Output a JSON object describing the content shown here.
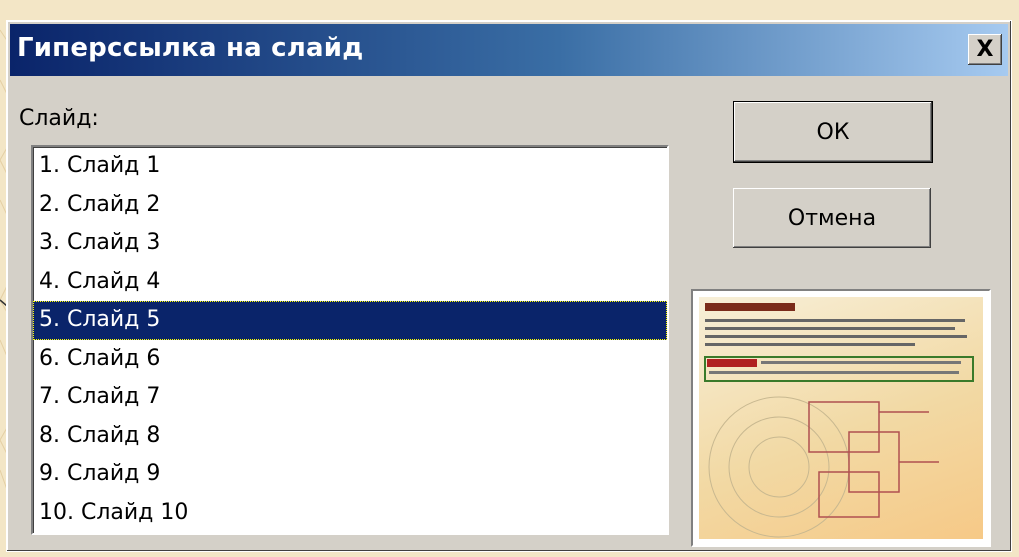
{
  "dialog": {
    "title": "Гиперссылка на слайд",
    "close_label": "X"
  },
  "list": {
    "label": "Слайд:",
    "items": [
      {
        "label": "1. Слайд 1"
      },
      {
        "label": "2. Слайд 2"
      },
      {
        "label": "3. Слайд 3"
      },
      {
        "label": "4. Слайд 4"
      },
      {
        "label": "5. Слайд 5",
        "selected": true
      },
      {
        "label": "6. Слайд 6"
      },
      {
        "label": "7. Слайд 7"
      },
      {
        "label": "8. Слайд 8"
      },
      {
        "label": "9. Слайд 9"
      },
      {
        "label": "10. Слайд 10"
      }
    ]
  },
  "buttons": {
    "ok_label": "ОК",
    "cancel_label": "Отмена"
  },
  "colors": {
    "titlebar_start": "#0a246a",
    "selection": "#0a246a",
    "dialog_face": "#d4d0c8"
  }
}
